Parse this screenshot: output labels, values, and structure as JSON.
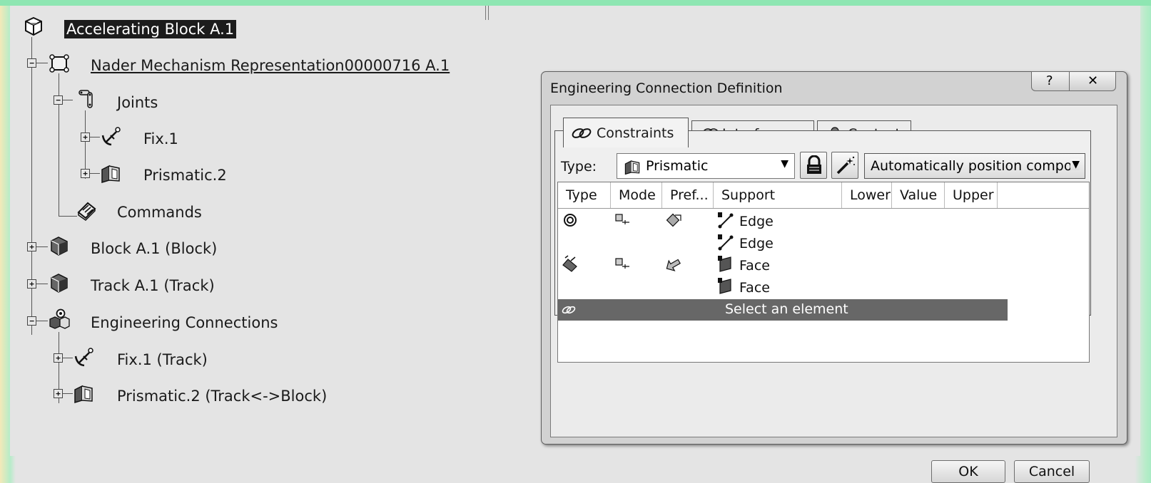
{
  "tree": {
    "root": {
      "label": "Accelerating Block A.1",
      "icon": "assembly-icon"
    },
    "items": [
      {
        "label": "Nader Mechanism Representation00000716 A.1",
        "icon": "mechanism-icon",
        "expander": "−"
      },
      {
        "label": "Joints",
        "icon": "joints-icon",
        "expander": "−"
      },
      {
        "label": "Fix.1",
        "icon": "fix-anchor-icon",
        "expander": "+"
      },
      {
        "label": "Prismatic.2",
        "icon": "prismatic-joint-icon",
        "expander": "+"
      },
      {
        "label": "Commands",
        "icon": "commands-icon"
      },
      {
        "label": "Block A.1 (Block)",
        "icon": "part-icon",
        "expander": "+"
      },
      {
        "label": "Track A.1 (Track)",
        "icon": "part-icon",
        "expander": "+"
      },
      {
        "label": "Engineering Connections",
        "icon": "engineering-connections-icon",
        "expander": "−"
      },
      {
        "label": "Fix.1 (Track)",
        "icon": "fix-anchor-icon",
        "expander": "+"
      },
      {
        "label": "Prismatic.2 (Track<->Block)",
        "icon": "prismatic-joint-icon",
        "expander": "+"
      }
    ]
  },
  "dialog": {
    "title": "Engineering Connection Definition",
    "help_glyph": "?",
    "close_glyph": "✕",
    "tabs": [
      {
        "label": "Constraints",
        "icon": "constraints-icon",
        "active": true
      },
      {
        "label": "Interferences",
        "icon": "interferences-icon",
        "active": false
      },
      {
        "label": "Contact",
        "icon": "contact-icon",
        "active": false
      }
    ],
    "type_label": "Type:",
    "type_value": "Prismatic",
    "lock_icon": "lock-icon",
    "wand_icon": "magic-wand-icon",
    "auto_position": "Automatically position compor",
    "table": {
      "columns": [
        "Type",
        "Mode",
        "Pref...",
        "Support",
        "Lower",
        "Value",
        "Upper"
      ],
      "rows": [
        {
          "type_icon": "coincidence-icon",
          "mode_icon": "mode-icon",
          "pref_icon": "preference-icon",
          "support": [
            "Edge",
            "Edge"
          ]
        },
        {
          "type_icon": "contact-surface-icon",
          "mode_icon": "mode-icon",
          "pref_icon": "preference-icon",
          "support": [
            "Face",
            "Face"
          ]
        }
      ],
      "select_row": {
        "icon": "chain-link-icon",
        "text": "Select an element"
      }
    },
    "ok_label": "OK",
    "cancel_label": "Cancel"
  }
}
